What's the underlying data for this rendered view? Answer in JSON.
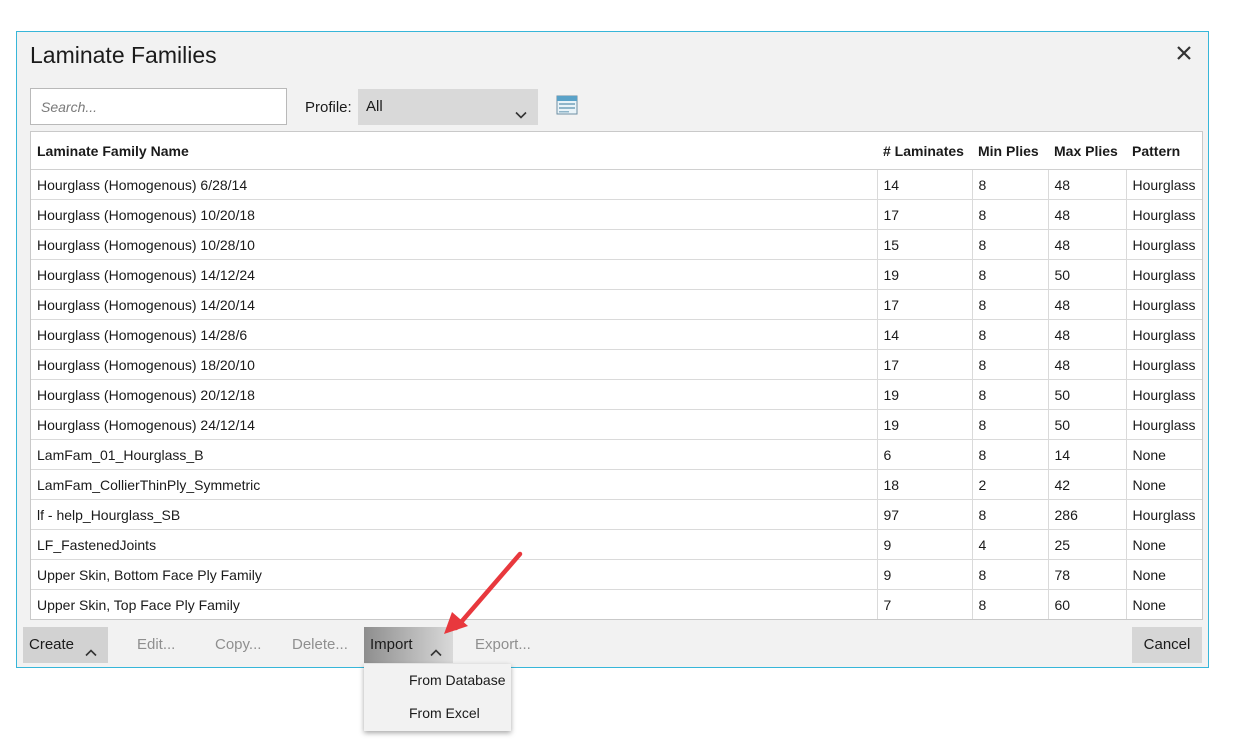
{
  "dialog": {
    "title": "Laminate Families"
  },
  "search": {
    "placeholder": "Search..."
  },
  "profile": {
    "label": "Profile:",
    "value": "All"
  },
  "table": {
    "columns": [
      "Laminate Family Name",
      "# Laminates",
      "Min Plies",
      "Max Plies",
      "Pattern"
    ],
    "rows": [
      [
        "Hourglass (Homogenous) 6/28/14",
        "14",
        "8",
        "48",
        "Hourglass"
      ],
      [
        "Hourglass (Homogenous) 10/20/18",
        "17",
        "8",
        "48",
        "Hourglass"
      ],
      [
        "Hourglass (Homogenous) 10/28/10",
        "15",
        "8",
        "48",
        "Hourglass"
      ],
      [
        "Hourglass (Homogenous) 14/12/24",
        "19",
        "8",
        "50",
        "Hourglass"
      ],
      [
        "Hourglass (Homogenous) 14/20/14",
        "17",
        "8",
        "48",
        "Hourglass"
      ],
      [
        "Hourglass (Homogenous) 14/28/6",
        "14",
        "8",
        "48",
        "Hourglass"
      ],
      [
        "Hourglass (Homogenous) 18/20/10",
        "17",
        "8",
        "48",
        "Hourglass"
      ],
      [
        "Hourglass (Homogenous) 20/12/18",
        "19",
        "8",
        "50",
        "Hourglass"
      ],
      [
        "Hourglass (Homogenous) 24/12/14",
        "19",
        "8",
        "50",
        "Hourglass"
      ],
      [
        "LamFam_01_Hourglass_B",
        "6",
        "8",
        "14",
        "None"
      ],
      [
        "LamFam_CollierThinPly_Symmetric",
        "18",
        "2",
        "42",
        "None"
      ],
      [
        "lf - help_Hourglass_SB",
        "97",
        "8",
        "286",
        "Hourglass"
      ],
      [
        "LF_FastenedJoints",
        "9",
        "4",
        "25",
        "None"
      ],
      [
        "Upper Skin, Bottom Face Ply Family",
        "9",
        "8",
        "78",
        "None"
      ],
      [
        "Upper Skin, Top Face Ply Family",
        "7",
        "8",
        "60",
        "None"
      ]
    ]
  },
  "buttons": {
    "create": "Create",
    "edit": "Edit...",
    "copy": "Copy...",
    "delete": "Delete...",
    "import": "Import",
    "export": "Export...",
    "cancel": "Cancel"
  },
  "import_menu": {
    "items": [
      "From Database",
      "From Excel"
    ]
  },
  "colors": {
    "dialog_border": "#37b6d9",
    "annotation_arrow": "#e8383d"
  }
}
